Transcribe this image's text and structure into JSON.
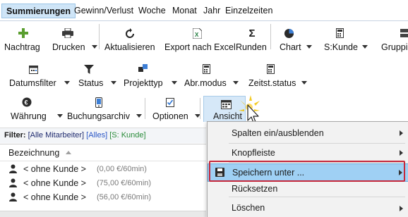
{
  "tabs": [
    "Summierungen",
    "Gewinn/Verlust",
    "Woche",
    "Monat",
    "Jahr",
    "Einzelzeiten"
  ],
  "toolbar_row1": {
    "nachtrag": "Nachtrag",
    "drucken": "Drucken",
    "aktualisieren": "Aktualisieren",
    "export": "Export nach Excel",
    "runden": "Runden",
    "chart": "Chart",
    "skunde": "S:Kunde",
    "gruppie": "Gruppie"
  },
  "toolbar_row2": {
    "datumsfilter": "Datumsfilter",
    "status": "Status",
    "projekttyp": "Projekttyp",
    "abrmodus": "Abr.modus",
    "zeitststatus": "Zeitst.status"
  },
  "toolbar_row3": {
    "waehrung": "Währung",
    "buchungsarchiv": "Buchungsarchiv",
    "optionen": "Optionen",
    "ansicht": "Ansicht"
  },
  "filter": {
    "label": "Filter:",
    "employees": "[Alle Mitarbeiter]",
    "all": "[Alles]",
    "kunde": "[S: Kunde]"
  },
  "grid": {
    "column": "Bezeichnung",
    "rows": [
      {
        "name": "< ohne Kunde >",
        "amount": "(0,00 €/60min)"
      },
      {
        "name": "< ohne Kunde >",
        "amount": "(75,00 €/60min)"
      },
      {
        "name": "< ohne Kunde >",
        "amount": "(56,00 €/60min)"
      }
    ]
  },
  "menu": {
    "items": [
      "Spalten ein/ausblenden",
      "Knopfleiste",
      "Speichern unter ...",
      "Rücksetzen",
      "Löschen"
    ],
    "highlighted": "Speichern unter ..."
  },
  "colors": {
    "tab_active_bg": "#cfe5f7",
    "menu_highlight": "#9fd0f4",
    "annotation_red": "#c6273b",
    "plus_green": "#5a9e2f",
    "excel_green": "#1f7a3c"
  }
}
